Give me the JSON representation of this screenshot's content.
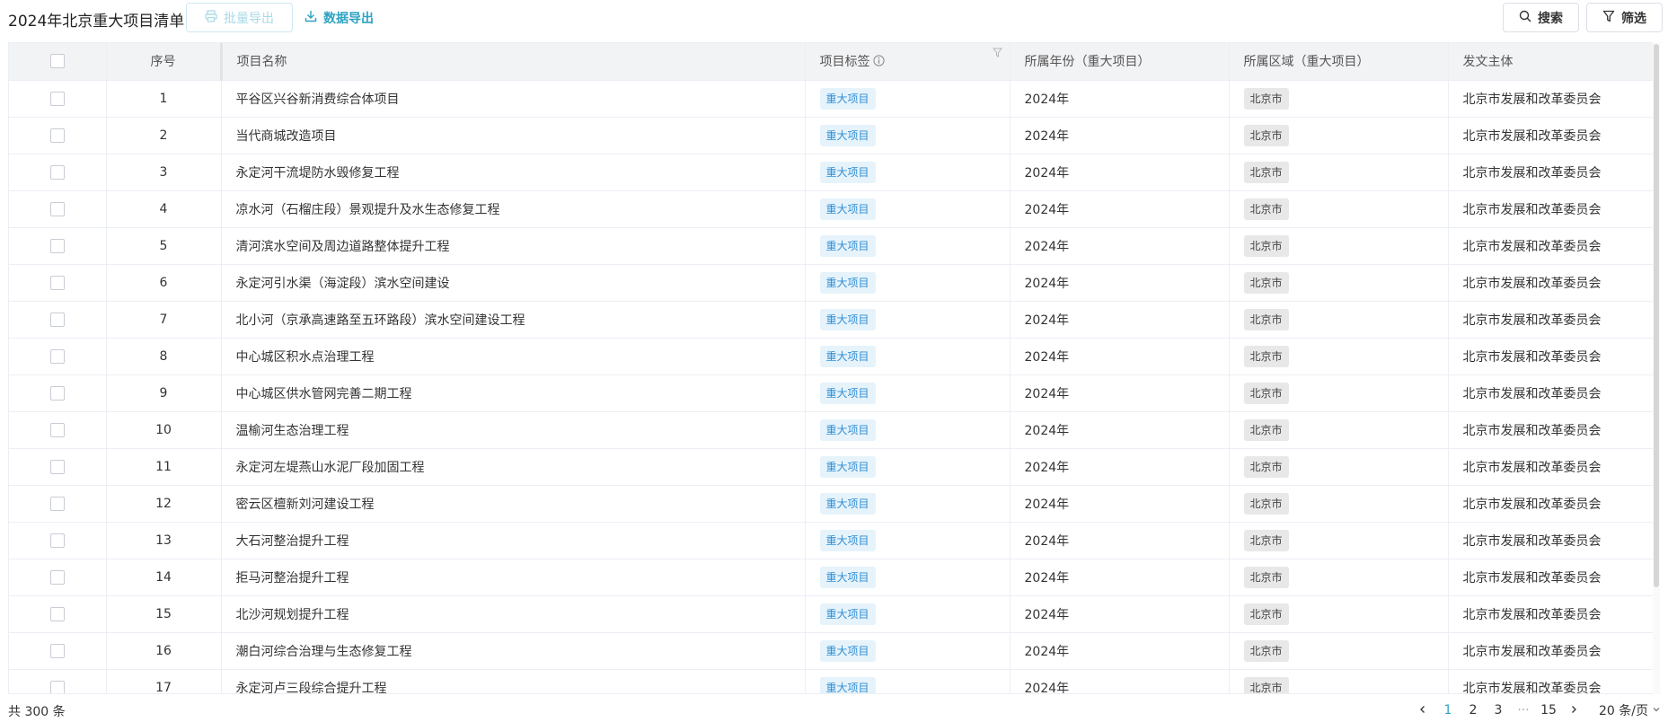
{
  "header": {
    "title": "2024年北京重大项目清单",
    "batch_export_label": "批量导出",
    "data_export_label": "数据导出",
    "search_label": "搜索",
    "filter_label": "筛选"
  },
  "table": {
    "columns": [
      "序号",
      "项目名称",
      "项目标签",
      "所属年份（重大项目）",
      "所属区域（重大项目）",
      "发文主体"
    ],
    "rows": [
      {
        "idx": "1",
        "name": "平谷区兴谷新消费综合体项目",
        "tag": "重大项目",
        "year": "2024年",
        "region": "北京市",
        "issuer": "北京市发展和改革委员会"
      },
      {
        "idx": "2",
        "name": "当代商城改造项目",
        "tag": "重大项目",
        "year": "2024年",
        "region": "北京市",
        "issuer": "北京市发展和改革委员会"
      },
      {
        "idx": "3",
        "name": "永定河干流堤防水毁修复工程",
        "tag": "重大项目",
        "year": "2024年",
        "region": "北京市",
        "issuer": "北京市发展和改革委员会"
      },
      {
        "idx": "4",
        "name": "凉水河（石榴庄段）景观提升及水生态修复工程",
        "tag": "重大项目",
        "year": "2024年",
        "region": "北京市",
        "issuer": "北京市发展和改革委员会"
      },
      {
        "idx": "5",
        "name": "清河滨水空间及周边道路整体提升工程",
        "tag": "重大项目",
        "year": "2024年",
        "region": "北京市",
        "issuer": "北京市发展和改革委员会"
      },
      {
        "idx": "6",
        "name": "永定河引水渠（海淀段）滨水空间建设",
        "tag": "重大项目",
        "year": "2024年",
        "region": "北京市",
        "issuer": "北京市发展和改革委员会"
      },
      {
        "idx": "7",
        "name": "北小河（京承高速路至五环路段）滨水空间建设工程",
        "tag": "重大项目",
        "year": "2024年",
        "region": "北京市",
        "issuer": "北京市发展和改革委员会"
      },
      {
        "idx": "8",
        "name": "中心城区积水点治理工程",
        "tag": "重大项目",
        "year": "2024年",
        "region": "北京市",
        "issuer": "北京市发展和改革委员会"
      },
      {
        "idx": "9",
        "name": "中心城区供水管网完善二期工程",
        "tag": "重大项目",
        "year": "2024年",
        "region": "北京市",
        "issuer": "北京市发展和改革委员会"
      },
      {
        "idx": "10",
        "name": "温榆河生态治理工程",
        "tag": "重大项目",
        "year": "2024年",
        "region": "北京市",
        "issuer": "北京市发展和改革委员会"
      },
      {
        "idx": "11",
        "name": "永定河左堤燕山水泥厂段加固工程",
        "tag": "重大项目",
        "year": "2024年",
        "region": "北京市",
        "issuer": "北京市发展和改革委员会"
      },
      {
        "idx": "12",
        "name": "密云区檀新刘河建设工程",
        "tag": "重大项目",
        "year": "2024年",
        "region": "北京市",
        "issuer": "北京市发展和改革委员会"
      },
      {
        "idx": "13",
        "name": "大石河整治提升工程",
        "tag": "重大项目",
        "year": "2024年",
        "region": "北京市",
        "issuer": "北京市发展和改革委员会"
      },
      {
        "idx": "14",
        "name": "拒马河整治提升工程",
        "tag": "重大项目",
        "year": "2024年",
        "region": "北京市",
        "issuer": "北京市发展和改革委员会"
      },
      {
        "idx": "15",
        "name": "北沙河规划提升工程",
        "tag": "重大项目",
        "year": "2024年",
        "region": "北京市",
        "issuer": "北京市发展和改革委员会"
      },
      {
        "idx": "16",
        "name": "潮白河综合治理与生态修复工程",
        "tag": "重大项目",
        "year": "2024年",
        "region": "北京市",
        "issuer": "北京市发展和改革委员会"
      },
      {
        "idx": "17",
        "name": "永定河卢三段综合提升工程",
        "tag": "重大项目",
        "year": "2024年",
        "region": "北京市",
        "issuer": "北京市发展和改革委员会"
      }
    ]
  },
  "footer": {
    "total": "共 300 条",
    "pages": [
      "1",
      "2",
      "3",
      "···",
      "15"
    ],
    "current_page": "1",
    "page_size": "20 条/页"
  },
  "colors": {
    "accent": "#2fa3c2",
    "tag_blue_text": "#2f8fd6",
    "tag_blue_bg": "#e6f3fb",
    "header_bg": "#f2f3f5"
  },
  "icons": {
    "batch_export": "printer-icon",
    "data_export": "download-icon",
    "search": "search-icon",
    "filter": "funnel-icon",
    "column_info": "info-icon",
    "column_filter": "funnel-icon",
    "prev": "chevron-left-icon",
    "next": "chevron-right-icon",
    "page_size_dropdown": "chevron-down-icon"
  }
}
